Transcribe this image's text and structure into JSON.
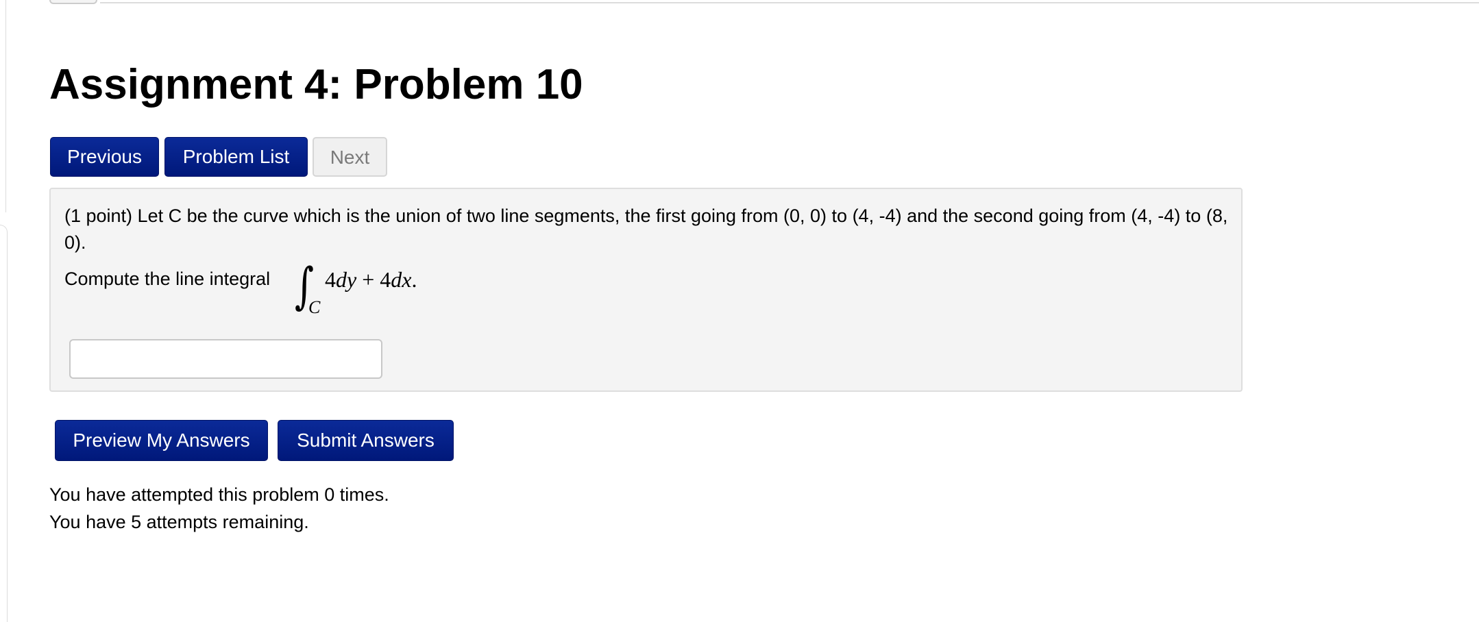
{
  "page": {
    "title": "Assignment 4: Problem 10"
  },
  "nav": {
    "previous_label": "Previous",
    "problem_list_label": "Problem List",
    "next_label": "Next"
  },
  "problem": {
    "statement": "(1 point) Let C be the curve which is the union of two line segments, the first going from (0, 0) to (4, -4) and the second going from (4, -4) to (8, 0).",
    "compute_label": "Compute the line integral",
    "integral_symbol": "∫",
    "integral_subscript": "C",
    "integrand": {
      "coef1": "4",
      "var1": "dy",
      "operator": " + ",
      "coef2": "4",
      "var2": "dx",
      "end": "."
    },
    "answer_value": ""
  },
  "actions": {
    "preview_label": "Preview My Answers",
    "submit_label": "Submit Answers"
  },
  "attempts": {
    "attempted_text": "You have attempted this problem 0 times.",
    "remaining_text": "You have 5 attempts remaining."
  },
  "colors": {
    "primary_button": "#00187a",
    "disabled_button": "#f0f0f0",
    "problem_background": "#f4f4f4"
  }
}
